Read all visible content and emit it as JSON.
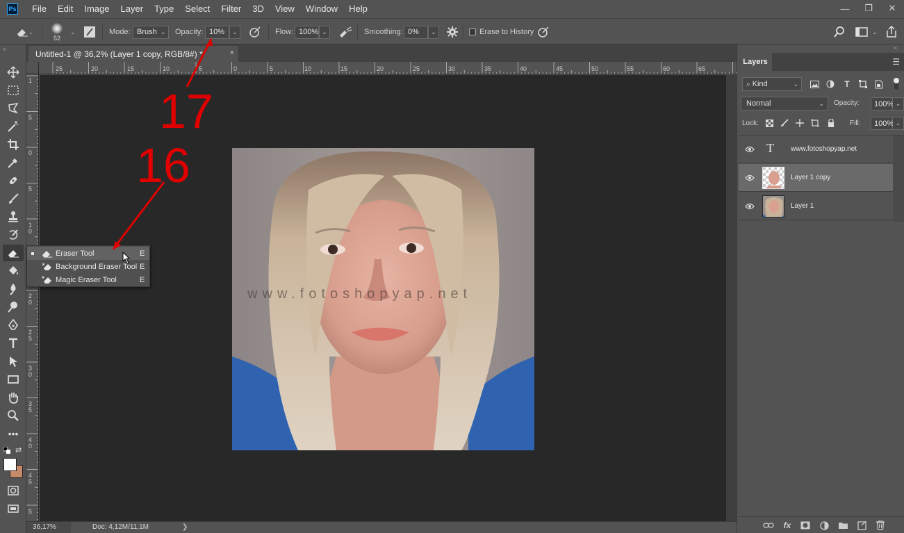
{
  "menubar": {
    "logo": "Ps",
    "items": [
      "File",
      "Edit",
      "Image",
      "Layer",
      "Type",
      "Select",
      "Filter",
      "3D",
      "View",
      "Window",
      "Help"
    ]
  },
  "window_controls": {
    "minimize": "—",
    "restore": "❐",
    "close": "✕"
  },
  "options": {
    "brush_size": "52",
    "mode_label": "Mode:",
    "mode_value": "Brush",
    "opacity_label": "Opacity:",
    "opacity_value": "10%",
    "flow_label": "Flow:",
    "flow_value": "100%",
    "smoothing_label": "Smoothing:",
    "smoothing_value": "0%",
    "erase_history_label": "Erase to History"
  },
  "document": {
    "tab_title": "Untitled-1 @ 36,2% (Layer 1 copy, RGB/8#) *",
    "close": "×"
  },
  "ruler_h": [
    "25",
    "20",
    "15",
    "10",
    "5",
    "0",
    "5",
    "10",
    "15",
    "20",
    "25",
    "30",
    "35",
    "40",
    "45",
    "50",
    "55",
    "60",
    "65"
  ],
  "ruler_v": [
    "1",
    "5",
    "0",
    "5",
    "1",
    "0",
    "1",
    "5",
    "2",
    "0",
    "2",
    "5",
    "3",
    "0",
    "3",
    "5",
    "4",
    "0",
    "4",
    "5",
    "5"
  ],
  "canvas": {
    "watermark": "www.fotoshopyap.net"
  },
  "flyout": {
    "items": [
      {
        "label": "Eraser Tool",
        "shortcut": "E"
      },
      {
        "label": "Background Eraser Tool",
        "shortcut": "E"
      },
      {
        "label": "Magic Eraser Tool",
        "shortcut": "E"
      }
    ]
  },
  "status": {
    "zoom": "36,17%",
    "doc": "Doc: 4,12M/11,1M",
    "arrow": "❯"
  },
  "layers_panel": {
    "tab": "Layers",
    "kind_label": "Kind",
    "blend_mode": "Normal",
    "opacity_label": "Opacity:",
    "opacity_value": "100%",
    "lock_label": "Lock:",
    "fill_label": "Fill:",
    "fill_value": "100%",
    "layers": [
      {
        "name": "www.fotoshopyap.net",
        "type": "text"
      },
      {
        "name": "Layer 1 copy",
        "type": "image"
      },
      {
        "name": "Layer 1",
        "type": "image"
      }
    ]
  },
  "annotations": {
    "label_17": "17",
    "label_16": "16",
    "color": "#e00000"
  },
  "colors": {
    "foreground": "#ffffff",
    "background": "#c68a6a",
    "accent_ps": "#31a8ff"
  }
}
